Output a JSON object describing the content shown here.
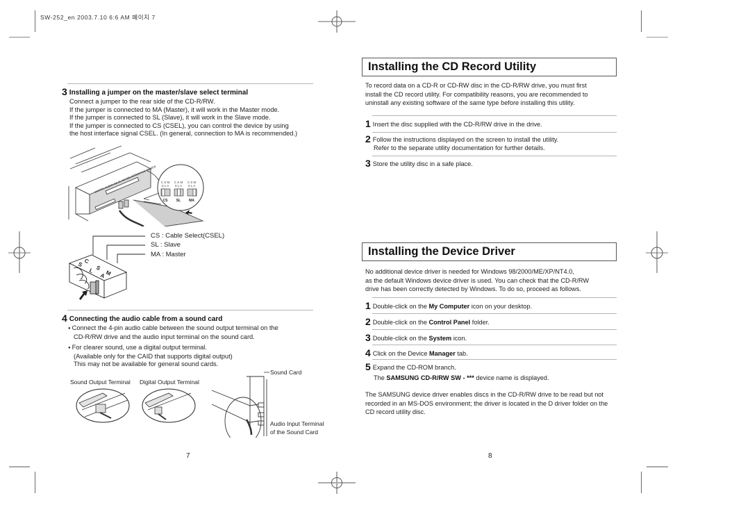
{
  "header": {
    "slug": "SW-252_en  2003.7.10 6:6 AM 페이지 7"
  },
  "left_page": {
    "step3": {
      "number": "3",
      "title": "Installing a jumper on the master/slave select terminal",
      "lines": [
        "Connect a jumper to the rear side of the CD-R/RW.",
        "If the jumper is connected to MA (Master), it will work in the Master mode.",
        "If the jumper is connected to SL (Slave), it will work in the Slave mode.",
        "If the jumper is connected to CS (CSEL), you can control the device by using",
        "the host interface signal CSEL. (In general, connection to MA is recommended.)"
      ]
    },
    "jumper_figure": {
      "closeup_pins": [
        "C S M",
        "S L A"
      ],
      "closeup_labels": [
        "CS",
        "SL",
        "MA"
      ],
      "callouts": [
        "CS : Cable Select(CSEL)",
        "SL : Slave",
        "MA : Master"
      ],
      "block_letters": [
        "C",
        "S",
        "M",
        "S",
        "L",
        "A"
      ]
    },
    "step4": {
      "number": "4",
      "title": "Connecting the audio cable from a sound card",
      "bullet1": [
        "Connect the 4-pin audio cable between the sound output terminal on the",
        "CD-R/RW drive and the audio input terminal on the sound card."
      ],
      "bullet2": [
        "For clearer sound, use a digital output terminal.",
        "(Available only for the CAID that supports digital output)",
        "This may not be available for general sound cards."
      ]
    },
    "audio_figure": {
      "sound_output_label": "Sound Output Terminal",
      "digital_output_label": "Digital Output Terminal",
      "sound_card_label": "Sound Card",
      "audio_input_label_1": "Audio Input Terminal",
      "audio_input_label_2": "of the Sound Card"
    },
    "page_number": "7"
  },
  "right_page": {
    "section1": {
      "title": "Installing the CD Record Utility",
      "intro": [
        "To record data on a CD-R or CD-RW disc in the CD-R/RW drive, you must first",
        "install the CD record utility. For compatibility reasons, you are recommended to",
        "uninstall any existing software of the same type before installing this utility."
      ],
      "steps": [
        {
          "num": "1",
          "lines": [
            "Insert the disc supplied with the CD-R/RW drive in the drive."
          ]
        },
        {
          "num": "2",
          "lines": [
            "Follow the instructions displayed on the screen to install the utility.",
            "Refer to the separate utility documentation for further details."
          ]
        },
        {
          "num": "3",
          "lines": [
            "Store the utility disc in a safe place."
          ]
        }
      ]
    },
    "section2": {
      "title": "Installing the Device Driver",
      "intro": [
        "No additional device driver is needed for Windows 98/2000/ME/XP/NT4.0,",
        "as the default Windows device driver is used. You can check that the CD-R/RW",
        "drive has been correctly detected by Windows. To do so, proceed as follows."
      ],
      "steps": [
        {
          "num": "1",
          "pre": "Double-click on the ",
          "bold": "My Computer",
          "post": " icon on your desktop."
        },
        {
          "num": "2",
          "pre": "Double-click on the ",
          "bold": "Control Panel",
          "post": " folder."
        },
        {
          "num": "3",
          "pre": "Double-click on the ",
          "bold": "System",
          "post": " icon."
        },
        {
          "num": "4",
          "pre": "Click on the Device ",
          "bold": "Manager",
          "post": " tab."
        },
        {
          "num": "5",
          "pre": "Expand the CD-ROM branch.",
          "bold": "",
          "post": ""
        }
      ],
      "step5_note": {
        "pre": "The ",
        "bold": "SAMSUNG CD-R/RW SW - ***",
        "post": " device name is displayed."
      },
      "footer": [
        "The SAMSUNG device driver enables discs in the CD-R/RW drive to be read but not",
        "recorded in an MS-DOS environment; the driver is located in the D driver folder on the",
        "CD record utility disc."
      ]
    },
    "page_number": "8"
  }
}
